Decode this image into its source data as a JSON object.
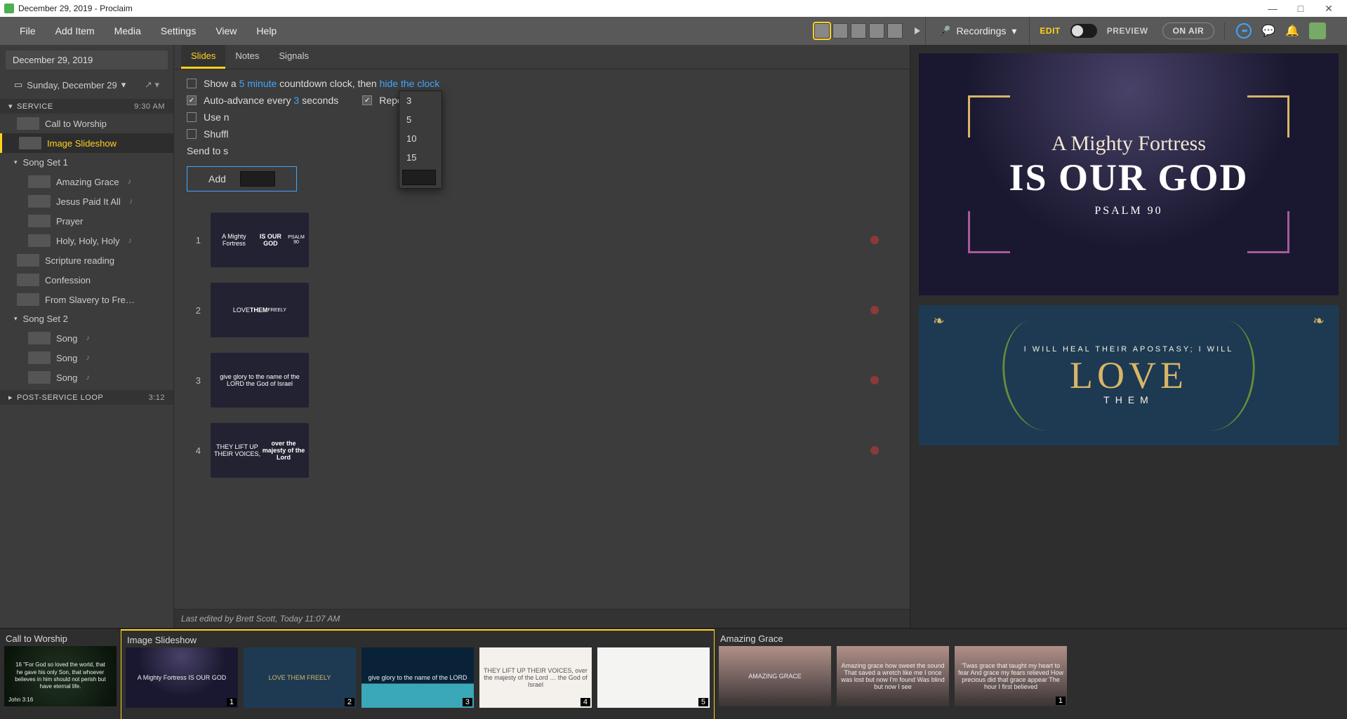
{
  "window": {
    "title": "December 29, 2019 - Proclaim"
  },
  "menubar": {
    "items": [
      "File",
      "Add Item",
      "Media",
      "Settings",
      "View",
      "Help"
    ],
    "recordings": "Recordings",
    "edit": "EDIT",
    "preview": "PREVIEW",
    "onair": "ON AIR"
  },
  "sidebar": {
    "presentation_title": "December 29, 2019",
    "date_label": "Sunday, December 29",
    "sections": [
      {
        "name": "SERVICE",
        "time": "9:30 AM"
      }
    ],
    "items": [
      {
        "label": "Call to Worship"
      },
      {
        "label": "Image Slideshow",
        "selected": true
      },
      {
        "label": "Song Set 1",
        "group": true
      },
      {
        "label": "Amazing Grace",
        "sub": true,
        "music": true
      },
      {
        "label": "Jesus Paid It All",
        "sub": true,
        "music": true
      },
      {
        "label": "Prayer",
        "sub": true
      },
      {
        "label": "Holy, Holy, Holy",
        "sub": true,
        "music": true
      },
      {
        "label": "Scripture reading"
      },
      {
        "label": "Confession"
      },
      {
        "label": "From Slavery to Fre…"
      },
      {
        "label": "Song Set 2",
        "group": true
      },
      {
        "label": "Song",
        "sub": true,
        "music": true
      },
      {
        "label": "Song",
        "sub": true,
        "music": true
      },
      {
        "label": "Song",
        "sub": true,
        "music": true
      }
    ],
    "post_loop": {
      "label": "POST-SERVICE LOOP",
      "time": "3:12"
    }
  },
  "tabs": {
    "items": [
      "Slides",
      "Notes",
      "Signals"
    ],
    "active": 0
  },
  "options": {
    "show_a": "Show a ",
    "five_minute": "5 minute",
    "countdown_then": " countdown clock, then ",
    "hide_clock": "hide the clock",
    "auto_advance_pre": "Auto-advance every ",
    "auto_advance_val": "3",
    "auto_advance_post": " seconds",
    "repeat": "Repeat",
    "use_n": "Use n",
    "shuffle": "Shuffl",
    "send_to": "Send to s",
    "add": "Add",
    "dropdown_values": [
      "3",
      "5",
      "10",
      "15"
    ]
  },
  "slides": [
    {
      "n": "1",
      "title": "A Mighty Fortress",
      "line2": "IS OUR GOD",
      "line3": "PSALM 90",
      "cls": "s-fortress"
    },
    {
      "n": "2",
      "title": "LOVE",
      "line2": "THEM",
      "line3": "FREELY",
      "cls": "s-love"
    },
    {
      "n": "3",
      "title": "give glory to the name of the LORD the God of Israel",
      "cls": "s-globe"
    },
    {
      "n": "4",
      "title": "THEY LIFT UP THEIR VOICES,",
      "line2": "over the majesty of the Lord",
      "cls": "s-voices"
    }
  ],
  "status": "Last edited by Brett Scott, Today 11:07 AM",
  "preview": {
    "slide1": {
      "t1": "A Mighty Fortress",
      "t2": "IS OUR GOD",
      "t3": "PSALM 90"
    },
    "slide2": {
      "arc": "I WILL HEAL THEIR APOSTASY; I WILL",
      "love": "LOVE",
      "them": "THEM"
    }
  },
  "filmstrip": {
    "groups": [
      {
        "title": "Call to Worship",
        "hl": false,
        "thumbs": [
          {
            "cls": "fs-worship",
            "badge": "",
            "text": "16 \"For God so loved the world, that he gave his only Son, that whoever believes in him should not perish but have eternal life.",
            "ref": "John 3:16"
          }
        ]
      },
      {
        "title": "Image Slideshow",
        "hl": true,
        "thumbs": [
          {
            "cls": "fs-fortress",
            "badge": "1",
            "text": "A Mighty Fortress IS OUR GOD"
          },
          {
            "cls": "fs-love",
            "badge": "2",
            "text": "LOVE THEM FREELY"
          },
          {
            "cls": "fs-globe",
            "badge": "3",
            "text": "give glory to the name of the LORD"
          },
          {
            "cls": "fs-voices",
            "badge": "4",
            "text": "THEY LIFT UP THEIR VOICES, over the majesty of the Lord … the God of Israel"
          },
          {
            "cls": "fs-leaf",
            "badge": "5",
            "text": ""
          }
        ]
      },
      {
        "title": "Amazing Grace",
        "hl": false,
        "thumbs": [
          {
            "cls": "fs-grace",
            "badge": "",
            "text": "AMAZING GRACE"
          },
          {
            "cls": "fs-grace",
            "badge": "",
            "text": "Amazing grace how sweet the sound That saved a wretch like me I once was lost but now I'm found Was blind but now I see"
          },
          {
            "cls": "fs-grace",
            "badge": "1",
            "text": "'Twas grace that taught my heart to fear And grace my fears relieved How precious did that grace appear The hour I first believed"
          }
        ]
      }
    ]
  }
}
